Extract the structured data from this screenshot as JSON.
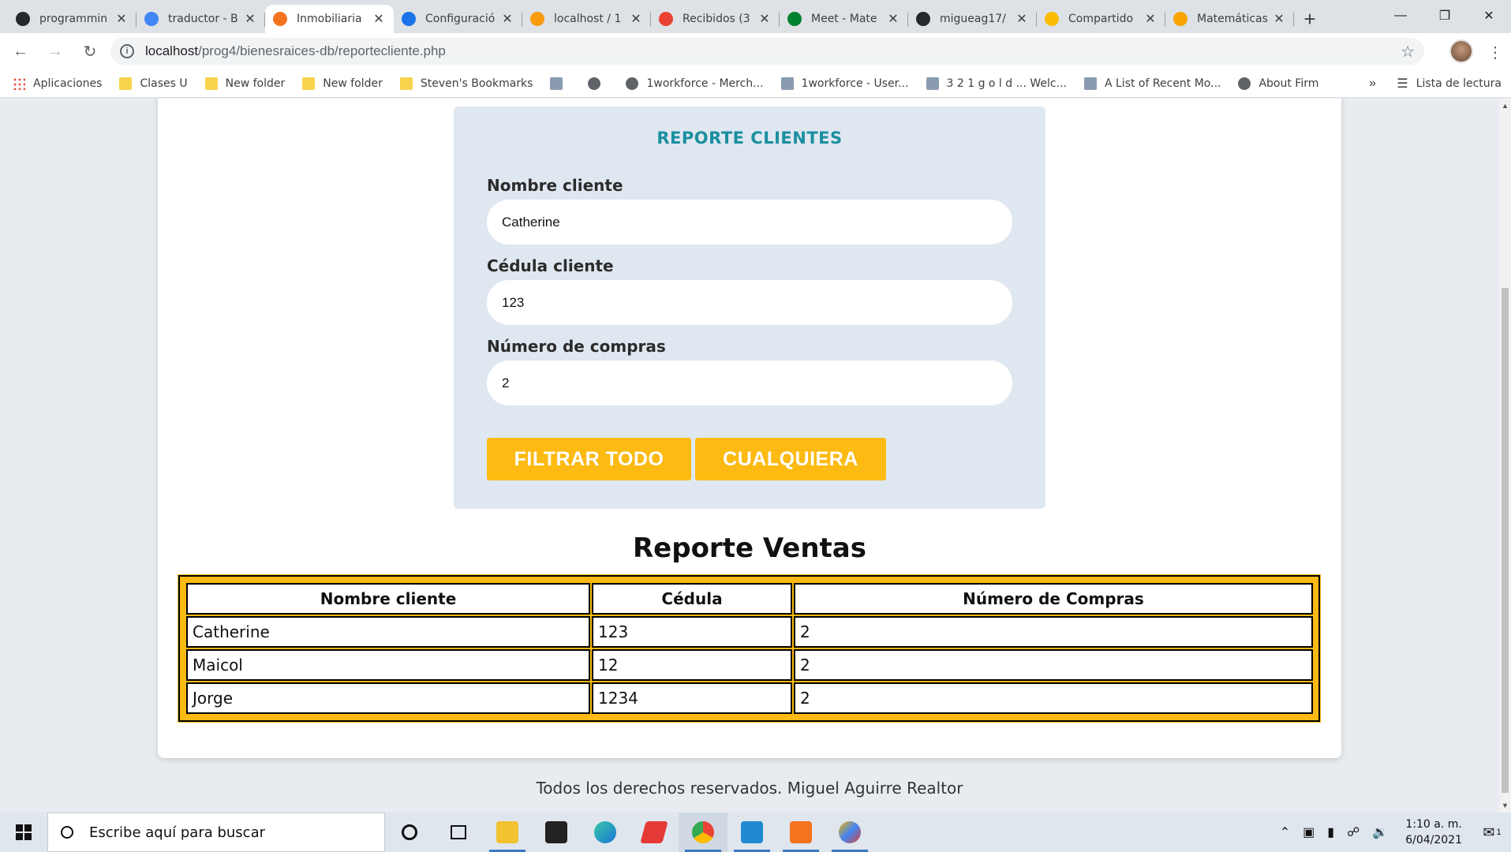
{
  "browser": {
    "tabs": [
      {
        "title": "programmin",
        "favicon": "github-icon",
        "color": "#24292e"
      },
      {
        "title": "traductor - B",
        "favicon": "google-icon",
        "color": "#4285f4"
      },
      {
        "title": "Inmobiliaria",
        "favicon": "xampp-icon",
        "color": "#f4731f",
        "active": true
      },
      {
        "title": "Configuració",
        "favicon": "settings-icon",
        "color": "#1a73e8"
      },
      {
        "title": "localhost / 1",
        "favicon": "phpmyadmin-icon",
        "color": "#f89c0e"
      },
      {
        "title": "Recibidos (3",
        "favicon": "gmail-icon",
        "color": "#ea4335"
      },
      {
        "title": "Meet - Mate",
        "favicon": "meet-icon",
        "color": "#00832d"
      },
      {
        "title": "migueag17/",
        "favicon": "github-icon",
        "color": "#24292e"
      },
      {
        "title": "Compartido",
        "favicon": "drive-icon",
        "color": "#fbbc04"
      },
      {
        "title": "Matemáticas",
        "favicon": "moodle-icon",
        "color": "#f7a400"
      }
    ],
    "new_tab": "+",
    "url_host": "localhost",
    "url_path": "/prog4/bienesraices-db/reportecliente.php",
    "bookmarks": [
      {
        "label": "Aplicaciones",
        "icon": "apps-grid-icon"
      },
      {
        "label": "Clases U",
        "icon": "folder-icon"
      },
      {
        "label": "New folder",
        "icon": "folder-icon"
      },
      {
        "label": "New folder",
        "icon": "folder-icon"
      },
      {
        "label": "Steven's Bookmarks",
        "icon": "folder-icon"
      },
      {
        "label": "",
        "icon": "document-icon"
      },
      {
        "label": "",
        "icon": "globe-icon"
      },
      {
        "label": "1workforce - Merch...",
        "icon": "globe-icon"
      },
      {
        "label": "1workforce - User...",
        "icon": "workforce-icon"
      },
      {
        "label": "3 2 1 g o l d ... Welc...",
        "icon": "321gold-icon"
      },
      {
        "label": "A List of Recent Mo...",
        "icon": "house-icon"
      },
      {
        "label": "About Firm",
        "icon": "globe-icon"
      }
    ],
    "overflow": "»",
    "reading_list": "Lista de lectura"
  },
  "form": {
    "title": "REPORTE CLIENTES",
    "fields": [
      {
        "label": "Nombre cliente",
        "value": "Catherine"
      },
      {
        "label": "Cédula cliente",
        "value": "123"
      },
      {
        "label": "Número de compras",
        "value": "2"
      }
    ],
    "buttons": {
      "filter_all": "FILTRAR TODO",
      "any": "CUALQUIERA"
    }
  },
  "report": {
    "heading": "Reporte Ventas",
    "columns": [
      "Nombre cliente",
      "Cédula",
      "Número de Compras"
    ],
    "rows": [
      [
        "Catherine",
        "123",
        "2"
      ],
      [
        "Maicol",
        "12",
        "2"
      ],
      [
        "Jorge",
        "1234",
        "2"
      ]
    ]
  },
  "footer": "Todos los derechos reservados. Miguel Aguirre Realtor",
  "taskbar": {
    "search_placeholder": "Escribe aquí para buscar",
    "time": "1:10 a. m.",
    "date": "6/04/2021",
    "notifications": "1"
  },
  "colors": {
    "accent": "#fcba12",
    "form_title": "#1a8fa0",
    "form_bg": "#dfe7f0"
  }
}
